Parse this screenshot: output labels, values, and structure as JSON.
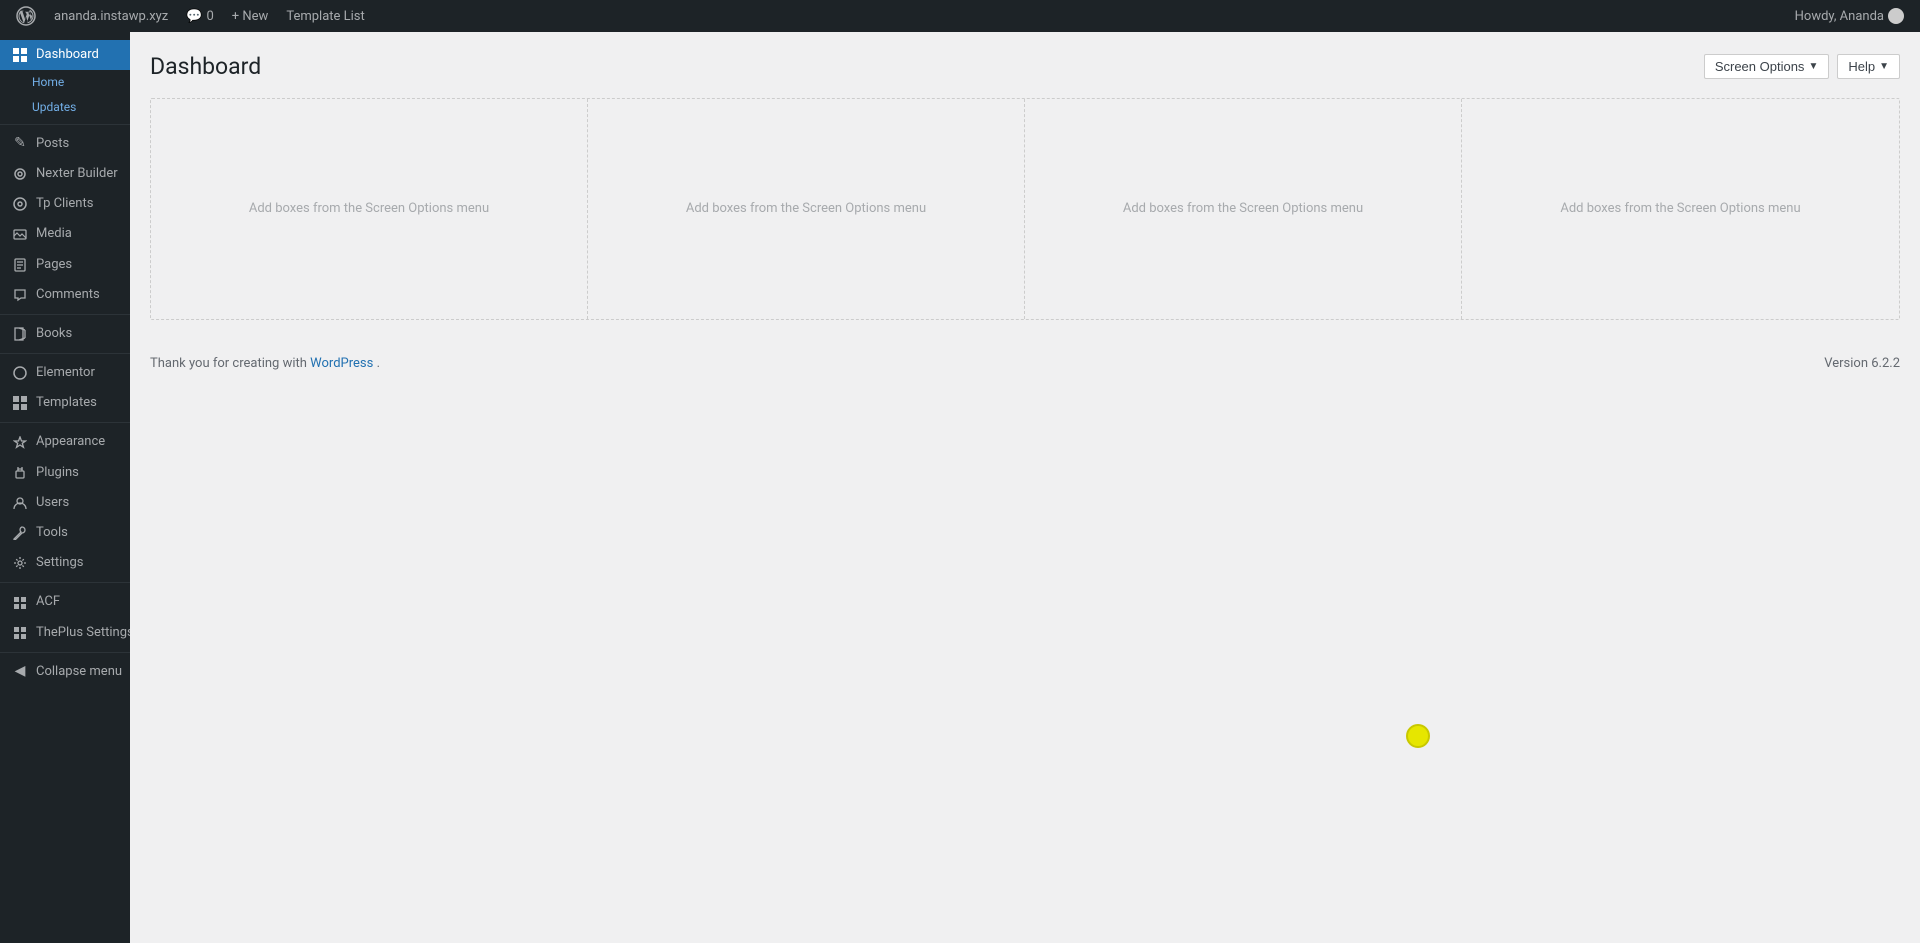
{
  "adminbar": {
    "wp_logo": "⚙",
    "site_name": "ananda.instawp.xyz",
    "comment_count": "0",
    "new_label": "+ New",
    "template_list_label": "Template List",
    "howdy_label": "Howdy, Ananda"
  },
  "sidebar": {
    "items": [
      {
        "id": "dashboard",
        "label": "Dashboard",
        "icon": "⊞",
        "active": true
      },
      {
        "id": "home",
        "label": "Home",
        "sub": true
      },
      {
        "id": "updates",
        "label": "Updates",
        "sub": true
      },
      {
        "id": "posts",
        "label": "Posts",
        "icon": "✎"
      },
      {
        "id": "nexter-builder",
        "label": "Nexter Builder",
        "icon": "⊕"
      },
      {
        "id": "tp-clients",
        "label": "Tp Clients",
        "icon": "◎"
      },
      {
        "id": "media",
        "label": "Media",
        "icon": "⊡"
      },
      {
        "id": "pages",
        "label": "Pages",
        "icon": "☰"
      },
      {
        "id": "comments",
        "label": "Comments",
        "icon": "✉"
      },
      {
        "id": "books",
        "label": "Books",
        "icon": "✏"
      },
      {
        "id": "elementor",
        "label": "Elementor",
        "icon": "⊕"
      },
      {
        "id": "templates",
        "label": "Templates",
        "icon": "⊞"
      },
      {
        "id": "appearance",
        "label": "Appearance",
        "icon": "🎨"
      },
      {
        "id": "plugins",
        "label": "Plugins",
        "icon": "⊞"
      },
      {
        "id": "users",
        "label": "Users",
        "icon": "👤"
      },
      {
        "id": "tools",
        "label": "Tools",
        "icon": "🔧"
      },
      {
        "id": "settings",
        "label": "Settings",
        "icon": "⚙"
      },
      {
        "id": "acf",
        "label": "ACF",
        "icon": "⊞"
      },
      {
        "id": "theplus-settings",
        "label": "ThePlus Settings",
        "icon": "⊞"
      },
      {
        "id": "collapse-menu",
        "label": "Collapse menu",
        "icon": "◀"
      }
    ]
  },
  "page": {
    "title": "Dashboard",
    "screen_options_label": "Screen Options",
    "help_label": "Help"
  },
  "dashboard": {
    "columns": [
      {
        "text": "Add boxes from the Screen Options menu"
      },
      {
        "text": "Add boxes from the Screen Options menu"
      },
      {
        "text": "Add boxes from the Screen Options menu"
      },
      {
        "text": "Add boxes from the Screen Options menu"
      }
    ]
  },
  "footer": {
    "thank_you_text": "Thank you for creating with",
    "wordpress_link": "WordPress",
    "version_text": "Version 6.2.2"
  }
}
